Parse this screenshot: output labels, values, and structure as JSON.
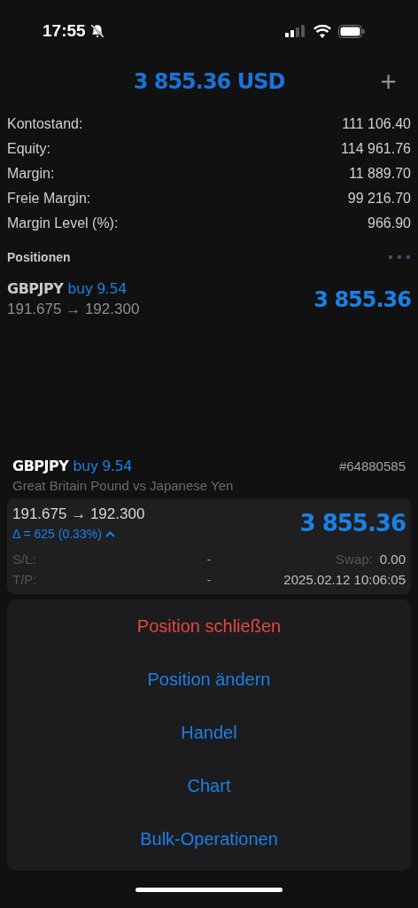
{
  "status_bar": {
    "time": "17:55",
    "muted": true
  },
  "header": {
    "title": "3 855.36 USD",
    "add": "+"
  },
  "account": [
    {
      "label": "Kontostand:",
      "value": "111 106.40"
    },
    {
      "label": "Equity:",
      "value": "114 961.76"
    },
    {
      "label": "Margin:",
      "value": "11 889.70"
    },
    {
      "label": "Freie Margin:",
      "value": "99 216.70"
    },
    {
      "label": "Margin Level (%):",
      "value": "966.90"
    }
  ],
  "positions_title": "Positionen",
  "positions": [
    {
      "symbol": "GBPJPY",
      "side": "buy 9.54",
      "prices": "191.675 → 192.300",
      "profit": "3 855.36"
    }
  ],
  "detail": {
    "symbol": "GBPJPY",
    "side": "buy 9.54",
    "ticket": "#64880585",
    "description": "Great Britain Pound vs Japanese Yen",
    "prices": "191.675 → 192.300",
    "delta": "Δ = 625 (0.33%)",
    "profit": "3 855.36",
    "sl_label": "S/L:",
    "sl_value": "-",
    "swap_label": "Swap:",
    "swap_value": "0.00",
    "tp_label": "T/P:",
    "tp_value": "-",
    "time": "2025.02.12 10:06:05"
  },
  "actions": [
    {
      "label": "Position schließen",
      "kind": "destructive"
    },
    {
      "label": "Position ändern",
      "kind": "default"
    },
    {
      "label": "Handel",
      "kind": "default"
    },
    {
      "label": "Chart",
      "kind": "default"
    },
    {
      "label": "Bulk-Operationen",
      "kind": "default"
    }
  ]
}
